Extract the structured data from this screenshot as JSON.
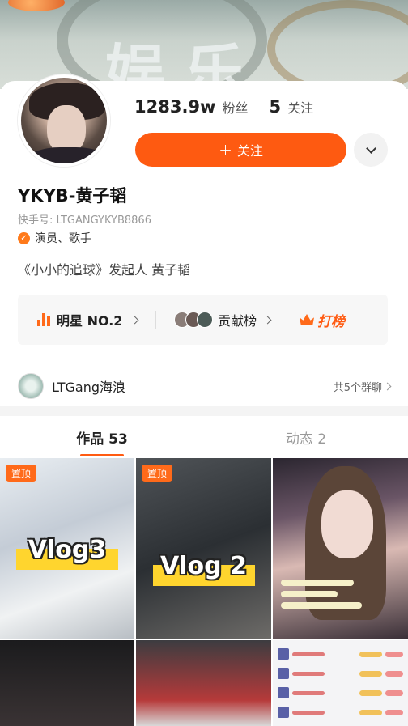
{
  "banner": {
    "calligraphy": "娱乐"
  },
  "profile": {
    "followers_count": "1283.9w",
    "followers_label": "粉丝",
    "following_count": "5",
    "following_label": "关注",
    "follow_button": "关注",
    "follow_icon": "plus-icon",
    "name": "YKYB-黄子韬",
    "kuaishou_id": "快手号: LTGANGYKYB8866",
    "verified_label": "演员、歌手",
    "bio": "《小小的追球》发起人 黄子韬"
  },
  "rank_bar": {
    "star_rank": "明星 NO.2",
    "contribution": "贡献榜",
    "hit_list": "打榜"
  },
  "group": {
    "name": "LTGang海浪",
    "count": "共5个群聊"
  },
  "tabs": [
    {
      "label": "作品 53",
      "active": true
    },
    {
      "label": "动态 2",
      "active": false
    }
  ],
  "videos": [
    {
      "pinned": "置顶",
      "caption": "Vlog3"
    },
    {
      "pinned": "置顶",
      "caption": "Vlog 2"
    },
    {
      "pinned": "",
      "caption": ""
    }
  ],
  "colors": {
    "accent": "#fe5a11",
    "banner": "#c9d2cc"
  }
}
